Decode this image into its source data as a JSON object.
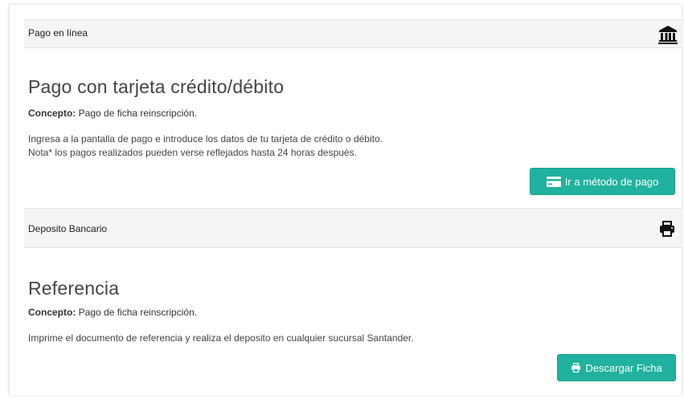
{
  "online": {
    "heading": "Pago en línea",
    "bank_icon": "bank-icon",
    "title": "Pago con tarjeta crédito/débito",
    "concept_label": "Concepto:",
    "concept_value": " Pago de ficha reinscripción.",
    "line1": "Ingresa a la pantalla de pago e introduce los datos de tu tarjeta de crédito o débito.",
    "line2": "Nota* los pagos realizados pueden verse reflejados hasta 24 horas después.",
    "button_label": "Ir a método de pago",
    "button_icon": "credit-card-icon"
  },
  "deposit": {
    "heading": "Deposito Bancario",
    "print_icon": "print-icon",
    "title": "Referencia",
    "concept_label": "Concepto:",
    "concept_value": " Pago de ficha reinscripción.",
    "line1": "Imprime el documento de referencia y realiza el deposito en cualquier sucursal Santander.",
    "button_label": "Descargar Ficha",
    "button_icon": "print-icon"
  },
  "colors": {
    "accent": "#20b29e",
    "heading_bg": "#f5f5f5"
  }
}
